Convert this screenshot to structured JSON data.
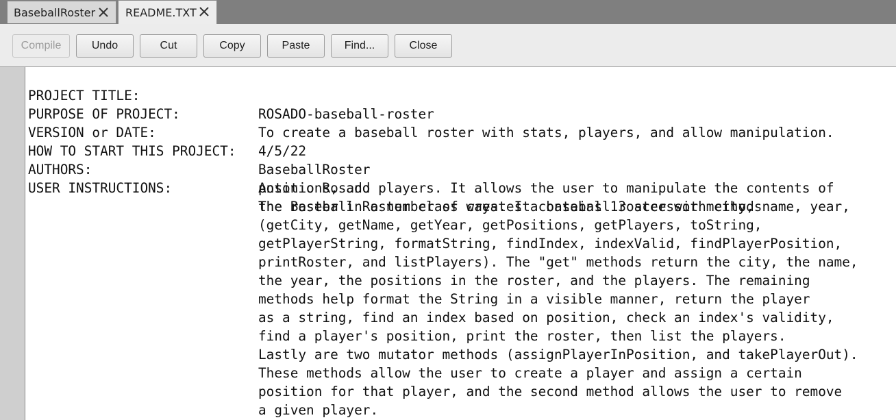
{
  "tabs": [
    {
      "label": "BaseballRoster",
      "active": false
    },
    {
      "label": "README.TXT",
      "active": true
    }
  ],
  "toolbar": {
    "compile": "Compile",
    "undo": "Undo",
    "cut": "Cut",
    "copy": "Copy",
    "paste": "Paste",
    "find": "Find...",
    "close": "Close"
  },
  "icons": {
    "tab_close": "close-icon"
  },
  "readme": {
    "fields": [
      {
        "key": "PROJECT TITLE:",
        "value": "ROSADO-baseball-roster"
      },
      {
        "key": "PURPOSE OF PROJECT:",
        "value": "To create a baseball roster with stats, players, and allow manipulation."
      },
      {
        "key": "VERSION or DATE:",
        "value": "4/5/22"
      },
      {
        "key": "HOW TO START THIS PROJECT:",
        "value": "BaseballRoster"
      },
      {
        "key": "AUTHORS:",
        "value": "Antonio Rosado"
      },
      {
        "key": "USER INSTRUCTIONS:",
        "value": "The Baseball Roster class creates a baseball roster with city, name, year,"
      }
    ],
    "instructions_continued": [
      "positions, and players. It allows the user to manipulate the contents of",
      "the roster in a number of ways. It contains 13 accessor methods",
      "(getCity, getName, getYear, getPositions, getPlayers, toString,",
      "getPlayerString, formatString, findIndex, indexValid, findPlayerPosition,",
      "printRoster, and listPlayers). The \"get\" methods return the city, the name,",
      "the year, the positions in the roster, and the players. The remaining",
      "methods help format the String in a visible manner, return the player",
      "as a string, find an index based on position, check an index's validity,",
      "find a player's position, print the roster, then list the players.",
      "Lastly are two mutator methods (assignPlayerInPosition, and takePlayerOut).",
      "These methods allow the user to create a player and assign a certain",
      "position for that player, and the second method allows the user to remove",
      "a given player."
    ]
  }
}
